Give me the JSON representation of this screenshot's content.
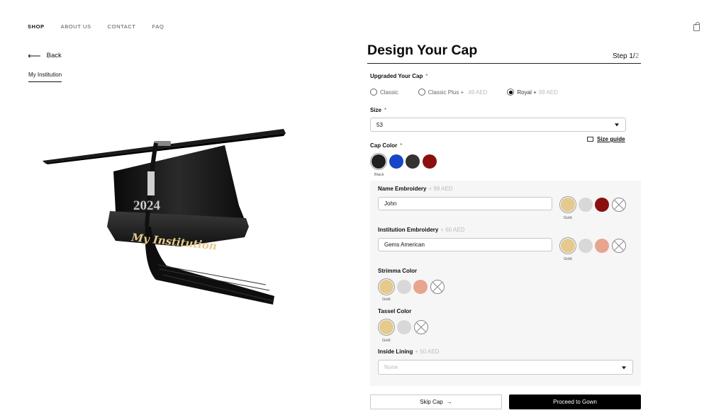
{
  "nav": {
    "items": [
      "SHOP",
      "ABOUT US",
      "CONTACT",
      "FAQ"
    ],
    "active": "SHOP",
    "cart_icon": "shopping-bag-icon"
  },
  "left": {
    "back_label": "Back",
    "institution_tab": "My Institution",
    "product_image": {
      "description_icon": "graduation-cap-image",
      "year_text": "2024",
      "band_text": "My Institution"
    }
  },
  "header": {
    "title": "Design Your Cap",
    "step_label": "Step 1/",
    "step_total": "2"
  },
  "upgrade": {
    "label": "Upgraded Your Cap",
    "required": "*",
    "options": [
      {
        "label": "Classic",
        "price": "",
        "selected": false
      },
      {
        "label": "Classic Plus +",
        "price": "49 AED",
        "selected": false
      },
      {
        "label": "Royal +",
        "price": "99 AED",
        "selected": true
      }
    ]
  },
  "size": {
    "label": "Size",
    "required": "*",
    "value": "53",
    "guide_label": "Size guide"
  },
  "cap_color": {
    "label": "Cap Color",
    "required": "*",
    "swatches": [
      "#1f1f1f",
      "#1846c9",
      "#333333",
      "#8a1010"
    ],
    "selected_name": "Black"
  },
  "name_embroidery": {
    "label": "Name Embroidery",
    "price": "+ 99 AED",
    "value": "John",
    "swatches": [
      "#e6c98c",
      "#d8d8d8",
      "#8a1010",
      "none"
    ],
    "selected_name": "Gold"
  },
  "institution_embroidery": {
    "label": "Institution Embroidery",
    "price": "+ 60 AED",
    "value": "Gems American",
    "swatches": [
      "#e6c98c",
      "#d8d8d8",
      "#e7a48e",
      "none"
    ],
    "selected_name": "Gold"
  },
  "strimma": {
    "label": "Strimma Color",
    "swatches": [
      "#e6c98c",
      "#d8d8d8",
      "#e7a48e",
      "none"
    ],
    "selected_name": "Gold"
  },
  "tassel": {
    "label": "Tassel Color",
    "swatches": [
      "#e6c98c",
      "#d8d8d8",
      "none"
    ],
    "selected_name": "Gold"
  },
  "lining": {
    "label": "Inside Lining",
    "price": "+ 50 AED",
    "placeholder": "None"
  },
  "actions": {
    "skip_label": "Skip Cap",
    "skip_arrow": "→",
    "proceed_label": "Proceed to Gown"
  }
}
